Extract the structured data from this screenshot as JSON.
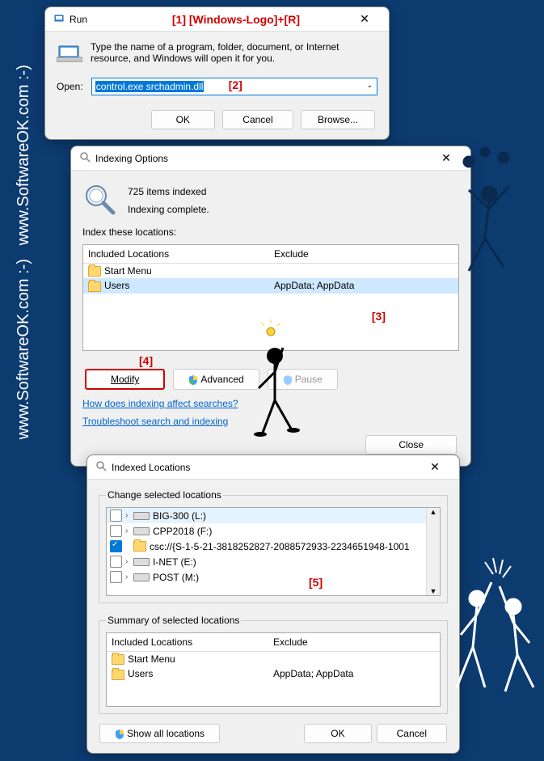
{
  "annotations": {
    "a1": "[1] [Windows-Logo]+[R]",
    "a2": "[2]",
    "a3": "[3]",
    "a4": "[4]",
    "a5": "[5]"
  },
  "run": {
    "title": "Run",
    "desc": "Type the name of a program, folder, document, or Internet resource, and Windows will open it for you.",
    "open_label": "Open:",
    "open_value": "control.exe srchadmin.dll",
    "ok": "OK",
    "cancel": "Cancel",
    "browse": "Browse..."
  },
  "idx": {
    "title": "Indexing Options",
    "count": "725 items indexed",
    "status": "Indexing complete.",
    "locations_label": "Index these locations:",
    "col_included": "Included Locations",
    "col_exclude": "Exclude",
    "rows": [
      {
        "name": "Start Menu",
        "exclude": ""
      },
      {
        "name": "Users",
        "exclude": "AppData; AppData"
      }
    ],
    "modify": "Modify",
    "advanced": "Advanced",
    "pause": "Pause",
    "help1": "How does indexing affect searches?",
    "help2": "Troubleshoot search and indexing",
    "close": "Close"
  },
  "loc": {
    "title": "Indexed Locations",
    "change_label": "Change selected locations",
    "items": [
      {
        "label": "BIG-300 (L:)",
        "checked": false,
        "type": "drive"
      },
      {
        "label": "CPP2018 (F:)",
        "checked": false,
        "type": "drive"
      },
      {
        "label": "csc://{S-1-5-21-3818252827-2088572933-2234651948-1001",
        "checked": true,
        "type": "folder"
      },
      {
        "label": "I-NET (E:)",
        "checked": false,
        "type": "drive"
      },
      {
        "label": "POST (M:)",
        "checked": false,
        "type": "drive"
      }
    ],
    "summary_label": "Summary of selected locations",
    "col_included": "Included Locations",
    "col_exclude": "Exclude",
    "sum_rows": [
      {
        "name": "Start Menu",
        "exclude": ""
      },
      {
        "name": "Users",
        "exclude": "AppData; AppData"
      }
    ],
    "show_all": "Show all locations",
    "ok": "OK",
    "cancel": "Cancel"
  },
  "wm": "www.SoftwareOK.com :-)",
  "side": "www.SoftwareOK.com :-)"
}
